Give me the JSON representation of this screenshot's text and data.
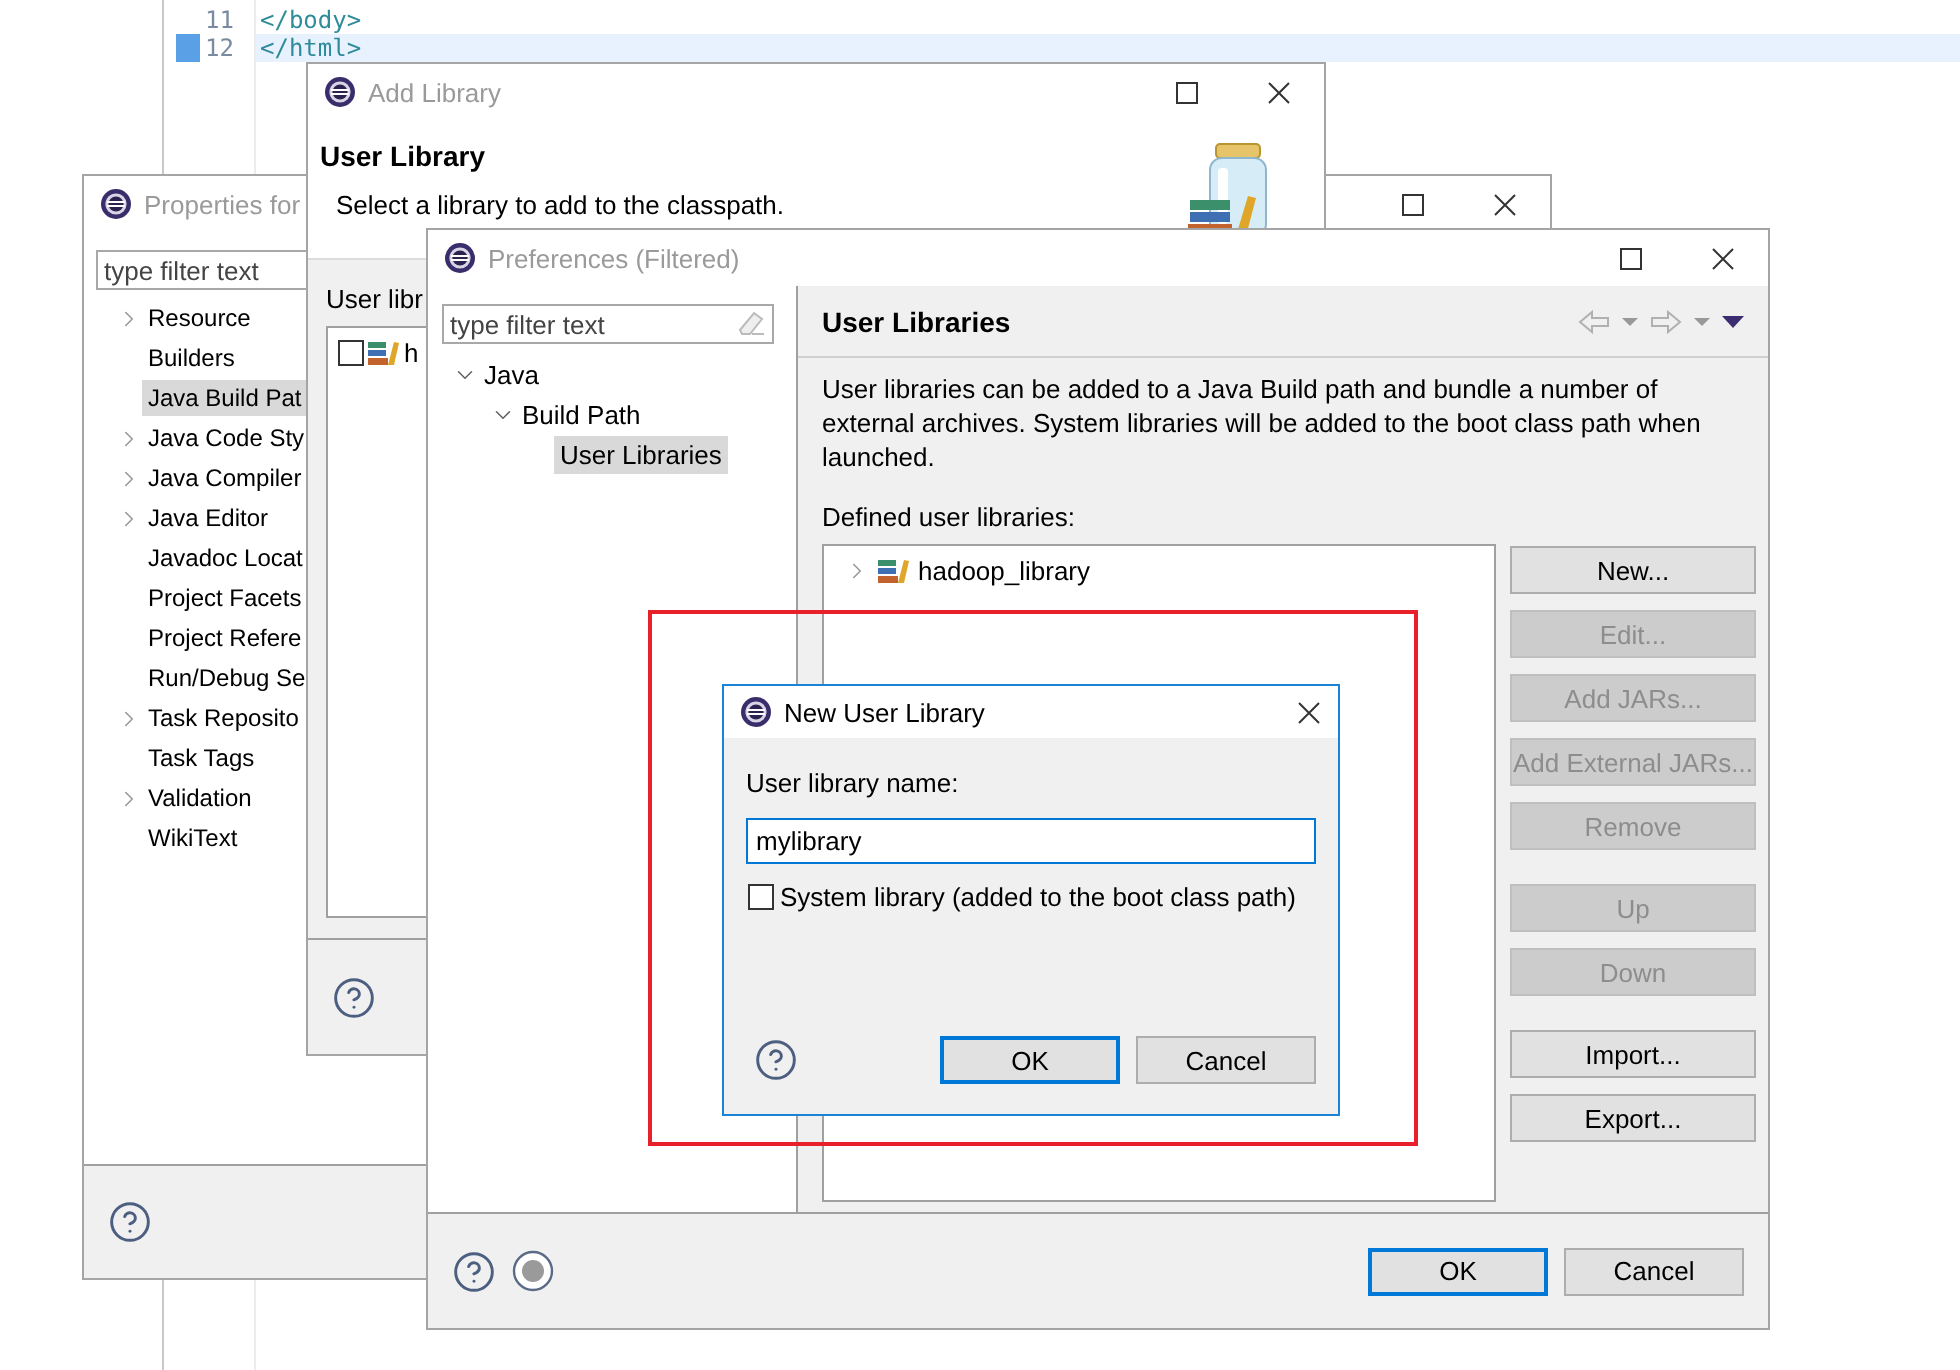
{
  "editor": {
    "lines": [
      {
        "number": "11",
        "code": "</body>",
        "current": false
      },
      {
        "number": "12",
        "code": "</html>",
        "current": true
      }
    ]
  },
  "properties_window": {
    "title": "Properties for",
    "active": false,
    "filter": {
      "placeholder": "type filter text"
    },
    "tree": [
      {
        "label": "Resource",
        "kind": "collapsed",
        "selected": false
      },
      {
        "label": "Builders",
        "kind": "leaf",
        "selected": false
      },
      {
        "label": "Java Build Pat",
        "kind": "leaf",
        "selected": true
      },
      {
        "label": "Java Code Sty",
        "kind": "collapsed",
        "selected": false
      },
      {
        "label": "Java Compiler",
        "kind": "collapsed",
        "selected": false
      },
      {
        "label": "Java Editor",
        "kind": "collapsed",
        "selected": false
      },
      {
        "label": "Javadoc Locat",
        "kind": "leaf",
        "selected": false
      },
      {
        "label": "Project Facets",
        "kind": "leaf",
        "selected": false
      },
      {
        "label": "Project Refere",
        "kind": "leaf",
        "selected": false
      },
      {
        "label": "Run/Debug Se",
        "kind": "leaf",
        "selected": false
      },
      {
        "label": "Task Reposito",
        "kind": "collapsed",
        "selected": false
      },
      {
        "label": "Task Tags",
        "kind": "leaf",
        "selected": false
      },
      {
        "label": "Validation",
        "kind": "collapsed",
        "selected": false
      },
      {
        "label": "WikiText",
        "kind": "leaf",
        "selected": false
      }
    ]
  },
  "add_library_window": {
    "title": "Add Library",
    "active": false,
    "heading": "User Library",
    "description": "Select a library to add to the classpath.",
    "list_label": "User libr",
    "libraries": [
      {
        "label": "h",
        "checked": false
      }
    ]
  },
  "preferences_window": {
    "title": "Preferences (Filtered)",
    "active": false,
    "filter": {
      "placeholder": "type filter text"
    },
    "tree": [
      {
        "label": "Java",
        "expanded": true,
        "selected": false,
        "children": [
          {
            "label": "Build Path",
            "expanded": true,
            "selected": false,
            "children": [
              {
                "label": "User Libraries",
                "selected": true
              }
            ]
          }
        ]
      }
    ],
    "page_title": "User Libraries",
    "description": "User libraries can be added to a Java Build path and bundle a number of external archives. System libraries will be added to the boot class path when launched.",
    "list_label": "Defined user libraries:",
    "libraries": [
      {
        "label": "hadoop_library",
        "expanded": false
      }
    ],
    "side_button_groups": [
      [
        {
          "label": "New...",
          "disabled": false
        },
        {
          "label": "Edit...",
          "disabled": true
        },
        {
          "label": "Add JARs...",
          "disabled": true
        },
        {
          "label": "Add External JARs...",
          "disabled": true
        },
        {
          "label": "Remove",
          "disabled": true
        }
      ],
      [
        {
          "label": "Up",
          "disabled": true
        },
        {
          "label": "Down",
          "disabled": true
        }
      ],
      [
        {
          "label": "Import...",
          "disabled": false
        },
        {
          "label": "Export...",
          "disabled": false
        }
      ]
    ],
    "buttons": [
      {
        "label": "OK",
        "default": true
      },
      {
        "label": "Cancel",
        "default": false
      }
    ]
  },
  "new_library_dialog": {
    "title": "New User Library",
    "active": true,
    "name_label": "User library name:",
    "name_value": "mylibrary",
    "system_library": {
      "label": "System library (added to the boot class path)",
      "checked": false
    },
    "buttons": [
      {
        "label": "OK",
        "default": true
      },
      {
        "label": "Cancel",
        "default": false
      }
    ]
  }
}
